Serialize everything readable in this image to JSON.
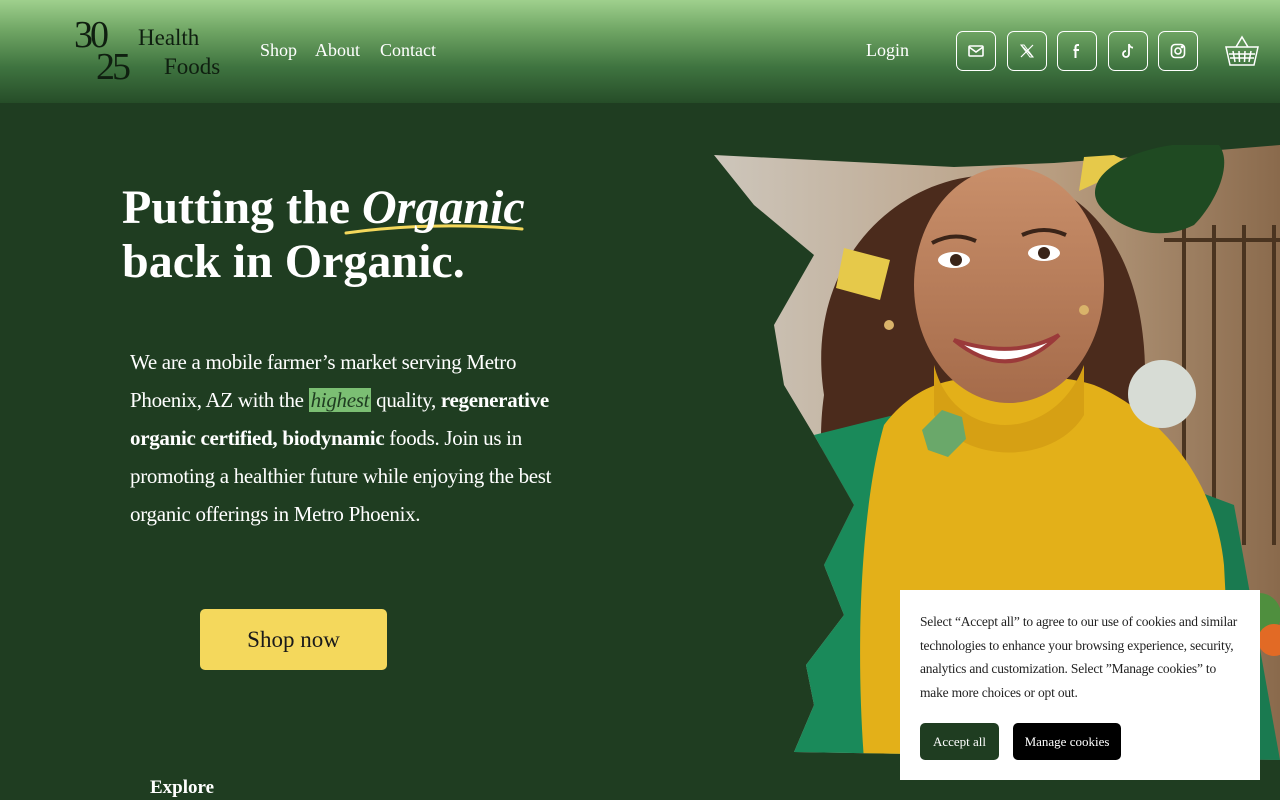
{
  "header": {
    "logo": {
      "num_top": "30",
      "num_bottom": "25",
      "word_top": "Health",
      "word_bottom": "Foods"
    },
    "nav": [
      {
        "label": "Shop"
      },
      {
        "label": "About"
      },
      {
        "label": "Contact"
      }
    ],
    "login_label": "Login",
    "social_icons": [
      "mail-icon",
      "x-icon",
      "facebook-icon",
      "tiktok-icon",
      "instagram-icon"
    ],
    "cart_icon": "basket-icon"
  },
  "hero": {
    "headline": {
      "line1_prefix": "Putting the ",
      "line1_em": "Organic",
      "line2_prefix": "back in ",
      "line2_bold": "Organic",
      "line2_suffix": "."
    },
    "paragraph": {
      "part1": "We are a mobile farmer’s market serving Metro Phoenix, AZ with the ",
      "highlight": "highest",
      "part2": " quality, ",
      "bold": "regenerative organic certified, biodynamic",
      "part3": " foods. Join us in promoting a healthier future while enjoying the best organic offerings in Metro Phoenix."
    },
    "cta_label": "Shop now",
    "explore_label": "Explore"
  },
  "cookie_banner": {
    "text": "Select “Accept all” to agree to our use of cookies and similar technologies to enhance your browsing experience, security, analytics and customization. Select ”Manage cookies” to make more choices or opt out.",
    "accept_label": "Accept all",
    "manage_label": "Manage cookies"
  },
  "colors": {
    "background": "#1f3d21",
    "accent_yellow": "#f4d85c",
    "highlight_green": "#7bbf73"
  }
}
